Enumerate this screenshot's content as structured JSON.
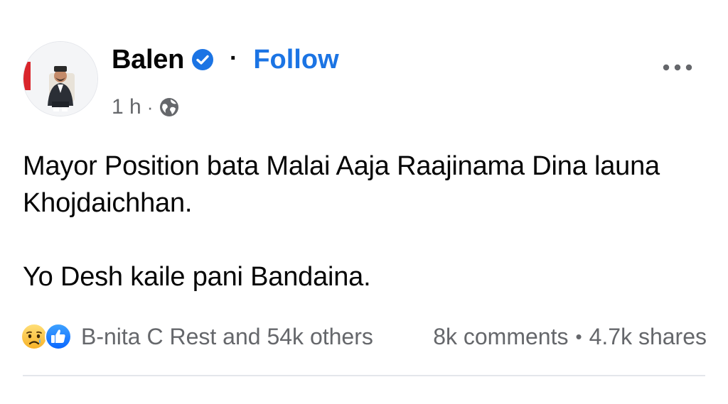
{
  "post": {
    "author": {
      "name": "Balen",
      "verified": true,
      "follow_label": "Follow",
      "separator": "·"
    },
    "meta": {
      "time": "1 h",
      "separator": "·",
      "audience_icon": "globe-icon"
    },
    "more_icon": "more-horizontal-icon",
    "text": {
      "paragraph_1": "Mayor Position bata Malai Aaja Raajinama Dina launa Khojdaichhan.",
      "paragraph_2": "Yo Desh kaile pani Bandaina."
    },
    "stats": {
      "reaction_icons": [
        "sad-reaction-icon",
        "like-reaction-icon"
      ],
      "reactors": "B-nita C Rest and 54k others",
      "comments": "8k comments",
      "separator": "•",
      "shares": "4.7k shares"
    }
  },
  "colors": {
    "link_blue": "#1b74e4",
    "verified_blue": "#1b74e4",
    "secondary_text": "#65676b",
    "primary_text": "#050505",
    "divider": "#e4e6eb",
    "top_strip": "#c9ccd1"
  }
}
